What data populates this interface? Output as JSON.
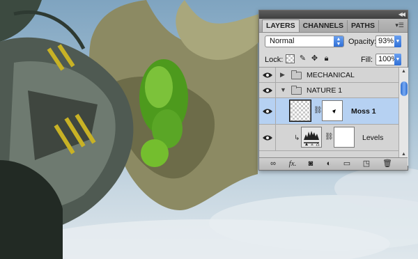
{
  "panel": {
    "tabs": [
      "LAYERS",
      "CHANNELS",
      "PATHS"
    ],
    "blend_mode": "Normal",
    "opacity_label": "Opacity:",
    "opacity_value": "93%",
    "lock_label": "Lock:",
    "fill_label": "Fill:",
    "fill_value": "100%",
    "layers": [
      {
        "name": "MECHANICAL",
        "type": "group",
        "expanded": false,
        "visible": true
      },
      {
        "name": "NATURE 1",
        "type": "group",
        "expanded": true,
        "visible": true
      },
      {
        "name": "Moss 1",
        "type": "layer",
        "selected": true,
        "visible": true
      },
      {
        "name": "Levels",
        "type": "adjustment",
        "clipped": true,
        "visible": true
      }
    ]
  },
  "colors": {
    "selection": "#b6d1f2",
    "accent": "#2f6fd6"
  }
}
